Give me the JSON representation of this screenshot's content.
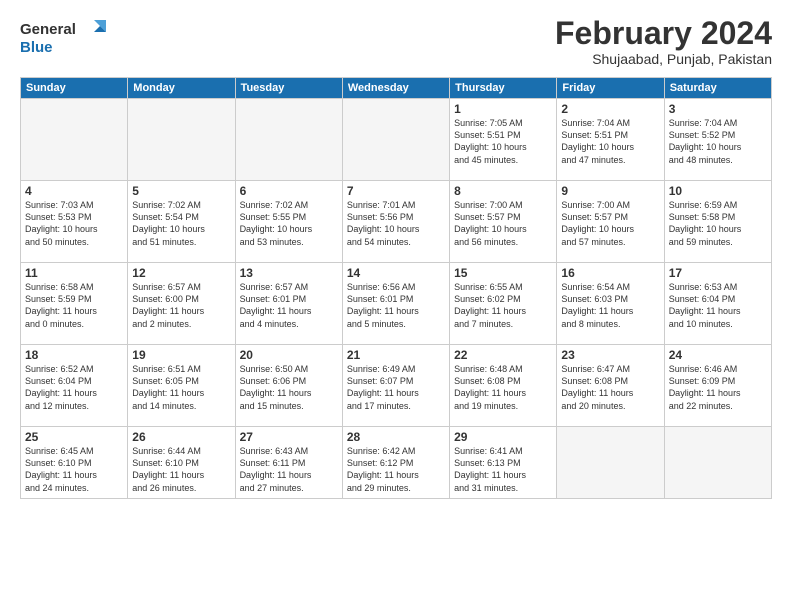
{
  "logo": {
    "line1": "General",
    "line2": "Blue"
  },
  "title": "February 2024",
  "location": "Shujaabad, Punjab, Pakistan",
  "weekdays": [
    "Sunday",
    "Monday",
    "Tuesday",
    "Wednesday",
    "Thursday",
    "Friday",
    "Saturday"
  ],
  "weeks": [
    [
      {
        "day": "",
        "info": ""
      },
      {
        "day": "",
        "info": ""
      },
      {
        "day": "",
        "info": ""
      },
      {
        "day": "",
        "info": ""
      },
      {
        "day": "1",
        "info": "Sunrise: 7:05 AM\nSunset: 5:51 PM\nDaylight: 10 hours\nand 45 minutes."
      },
      {
        "day": "2",
        "info": "Sunrise: 7:04 AM\nSunset: 5:51 PM\nDaylight: 10 hours\nand 47 minutes."
      },
      {
        "day": "3",
        "info": "Sunrise: 7:04 AM\nSunset: 5:52 PM\nDaylight: 10 hours\nand 48 minutes."
      }
    ],
    [
      {
        "day": "4",
        "info": "Sunrise: 7:03 AM\nSunset: 5:53 PM\nDaylight: 10 hours\nand 50 minutes."
      },
      {
        "day": "5",
        "info": "Sunrise: 7:02 AM\nSunset: 5:54 PM\nDaylight: 10 hours\nand 51 minutes."
      },
      {
        "day": "6",
        "info": "Sunrise: 7:02 AM\nSunset: 5:55 PM\nDaylight: 10 hours\nand 53 minutes."
      },
      {
        "day": "7",
        "info": "Sunrise: 7:01 AM\nSunset: 5:56 PM\nDaylight: 10 hours\nand 54 minutes."
      },
      {
        "day": "8",
        "info": "Sunrise: 7:00 AM\nSunset: 5:57 PM\nDaylight: 10 hours\nand 56 minutes."
      },
      {
        "day": "9",
        "info": "Sunrise: 7:00 AM\nSunset: 5:57 PM\nDaylight: 10 hours\nand 57 minutes."
      },
      {
        "day": "10",
        "info": "Sunrise: 6:59 AM\nSunset: 5:58 PM\nDaylight: 10 hours\nand 59 minutes."
      }
    ],
    [
      {
        "day": "11",
        "info": "Sunrise: 6:58 AM\nSunset: 5:59 PM\nDaylight: 11 hours\nand 0 minutes."
      },
      {
        "day": "12",
        "info": "Sunrise: 6:57 AM\nSunset: 6:00 PM\nDaylight: 11 hours\nand 2 minutes."
      },
      {
        "day": "13",
        "info": "Sunrise: 6:57 AM\nSunset: 6:01 PM\nDaylight: 11 hours\nand 4 minutes."
      },
      {
        "day": "14",
        "info": "Sunrise: 6:56 AM\nSunset: 6:01 PM\nDaylight: 11 hours\nand 5 minutes."
      },
      {
        "day": "15",
        "info": "Sunrise: 6:55 AM\nSunset: 6:02 PM\nDaylight: 11 hours\nand 7 minutes."
      },
      {
        "day": "16",
        "info": "Sunrise: 6:54 AM\nSunset: 6:03 PM\nDaylight: 11 hours\nand 8 minutes."
      },
      {
        "day": "17",
        "info": "Sunrise: 6:53 AM\nSunset: 6:04 PM\nDaylight: 11 hours\nand 10 minutes."
      }
    ],
    [
      {
        "day": "18",
        "info": "Sunrise: 6:52 AM\nSunset: 6:04 PM\nDaylight: 11 hours\nand 12 minutes."
      },
      {
        "day": "19",
        "info": "Sunrise: 6:51 AM\nSunset: 6:05 PM\nDaylight: 11 hours\nand 14 minutes."
      },
      {
        "day": "20",
        "info": "Sunrise: 6:50 AM\nSunset: 6:06 PM\nDaylight: 11 hours\nand 15 minutes."
      },
      {
        "day": "21",
        "info": "Sunrise: 6:49 AM\nSunset: 6:07 PM\nDaylight: 11 hours\nand 17 minutes."
      },
      {
        "day": "22",
        "info": "Sunrise: 6:48 AM\nSunset: 6:08 PM\nDaylight: 11 hours\nand 19 minutes."
      },
      {
        "day": "23",
        "info": "Sunrise: 6:47 AM\nSunset: 6:08 PM\nDaylight: 11 hours\nand 20 minutes."
      },
      {
        "day": "24",
        "info": "Sunrise: 6:46 AM\nSunset: 6:09 PM\nDaylight: 11 hours\nand 22 minutes."
      }
    ],
    [
      {
        "day": "25",
        "info": "Sunrise: 6:45 AM\nSunset: 6:10 PM\nDaylight: 11 hours\nand 24 minutes."
      },
      {
        "day": "26",
        "info": "Sunrise: 6:44 AM\nSunset: 6:10 PM\nDaylight: 11 hours\nand 26 minutes."
      },
      {
        "day": "27",
        "info": "Sunrise: 6:43 AM\nSunset: 6:11 PM\nDaylight: 11 hours\nand 27 minutes."
      },
      {
        "day": "28",
        "info": "Sunrise: 6:42 AM\nSunset: 6:12 PM\nDaylight: 11 hours\nand 29 minutes."
      },
      {
        "day": "29",
        "info": "Sunrise: 6:41 AM\nSunset: 6:13 PM\nDaylight: 11 hours\nand 31 minutes."
      },
      {
        "day": "",
        "info": ""
      },
      {
        "day": "",
        "info": ""
      }
    ]
  ]
}
